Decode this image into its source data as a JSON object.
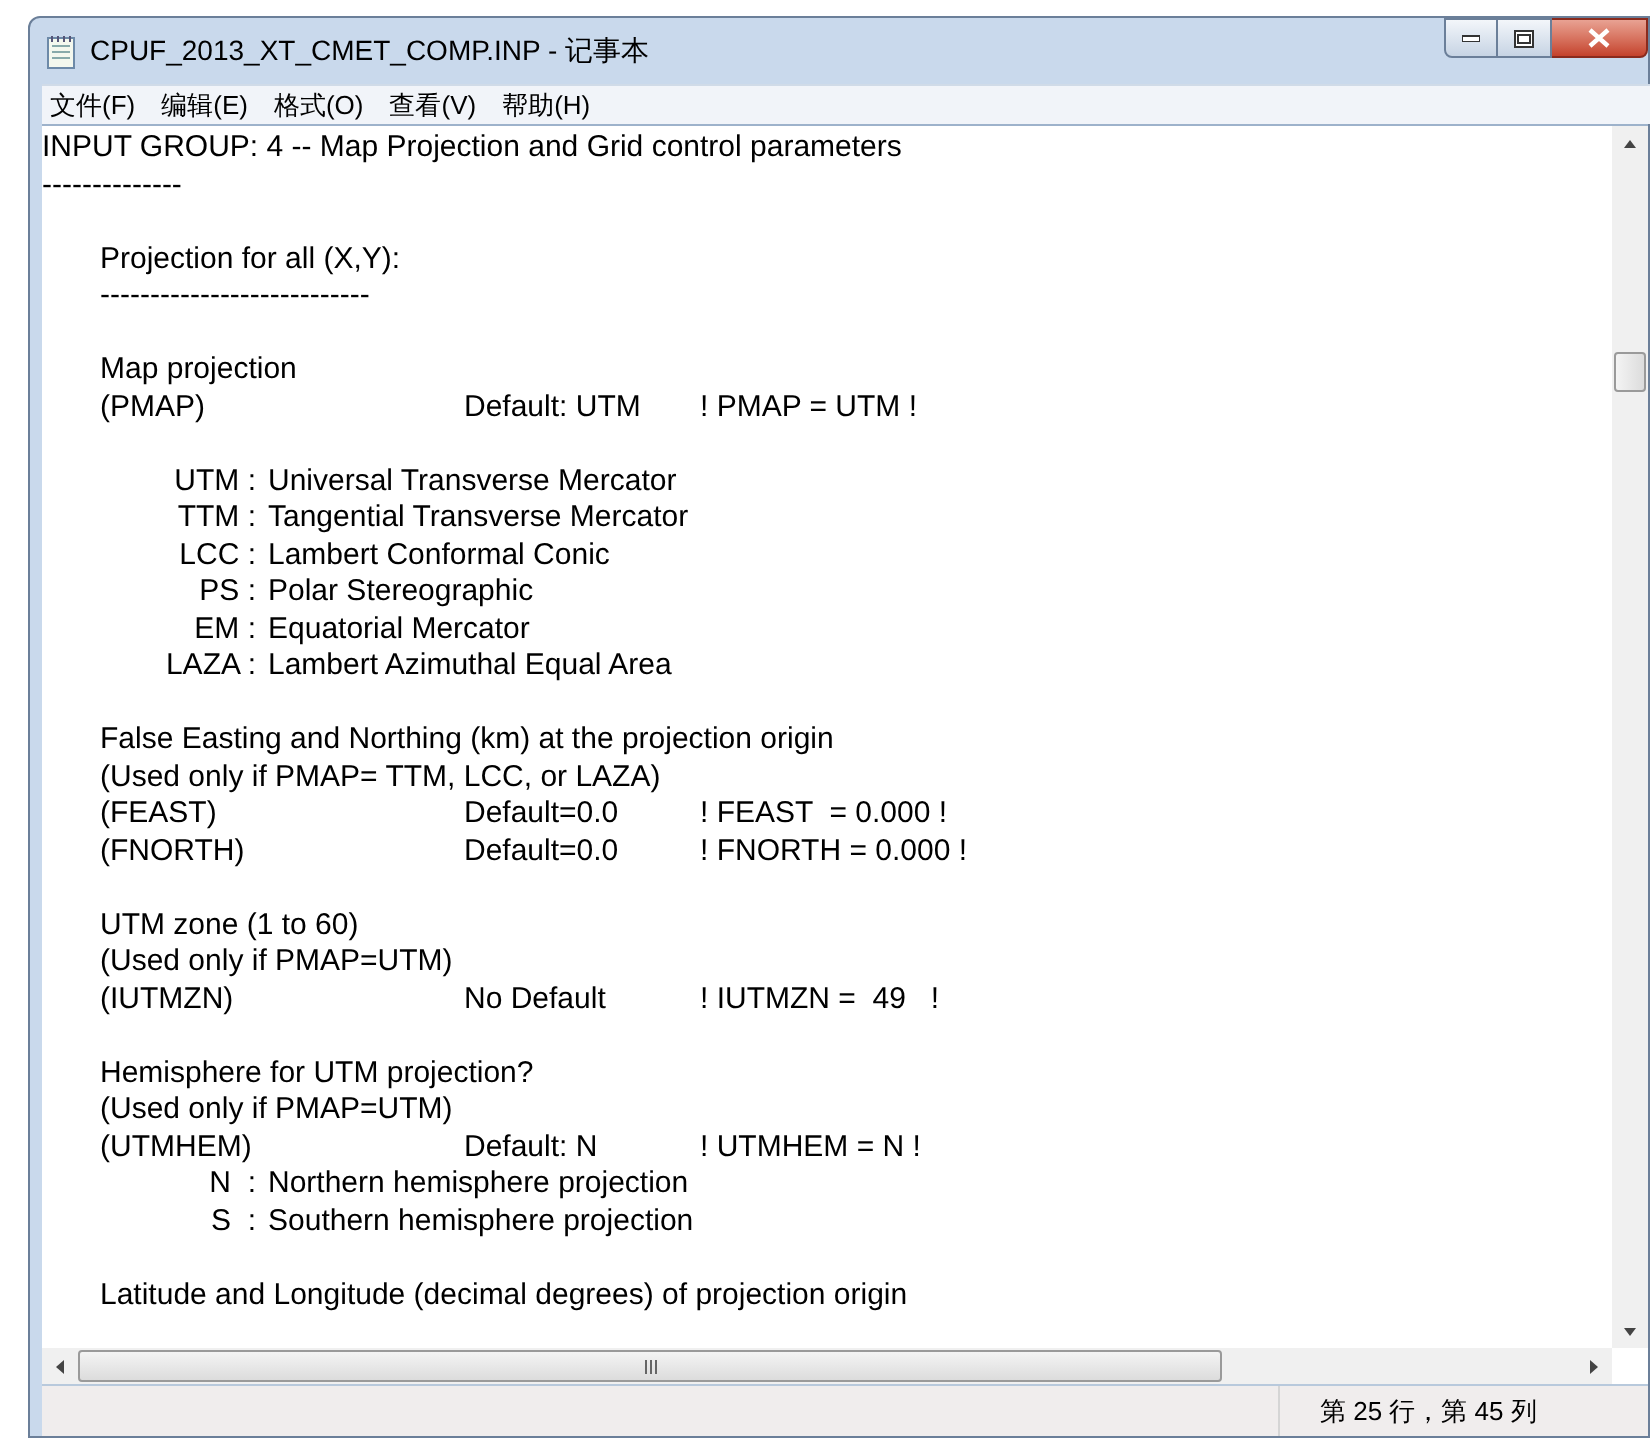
{
  "window": {
    "title": "CPUF_2013_XT_CMET_COMP.INP - 记事本"
  },
  "menu": [
    "文件(F)",
    "编辑(E)",
    "格式(O)",
    "查看(V)",
    "帮助(H)"
  ],
  "lines": [
    {
      "kind": "top",
      "text": "INPUT GROUP: 4 -- Map Projection and Grid control parameters"
    },
    {
      "kind": "top",
      "text": "--------------"
    },
    {
      "kind": "blank"
    },
    {
      "kind": "text",
      "text": "Projection for all (X,Y):"
    },
    {
      "kind": "text",
      "text": "---------------------------"
    },
    {
      "kind": "blank"
    },
    {
      "kind": "text",
      "text": "Map projection"
    },
    {
      "kind": "param",
      "name": "(PMAP)",
      "default": "Default: UTM",
      "value": "! PMAP = UTM !"
    },
    {
      "kind": "blank"
    },
    {
      "kind": "option",
      "code": "UTM :",
      "desc": "Universal Transverse Mercator"
    },
    {
      "kind": "option",
      "code": "TTM :",
      "desc": "Tangential Transverse Mercator"
    },
    {
      "kind": "option",
      "code": "LCC :",
      "desc": "Lambert Conformal Conic"
    },
    {
      "kind": "option",
      "code": "PS :",
      "desc": "Polar Stereographic"
    },
    {
      "kind": "option",
      "code": "EM :",
      "desc": "Equatorial Mercator"
    },
    {
      "kind": "option",
      "code": "LAZA :",
      "desc": "Lambert Azimuthal Equal Area"
    },
    {
      "kind": "blank"
    },
    {
      "kind": "text",
      "text": "False Easting and Northing (km) at the projection origin"
    },
    {
      "kind": "text",
      "text": "(Used only if PMAP= TTM, LCC, or LAZA)"
    },
    {
      "kind": "param",
      "name": "(FEAST)",
      "default": "Default=0.0",
      "value": "! FEAST  = 0.000 !"
    },
    {
      "kind": "param",
      "name": "(FNORTH)",
      "default": "Default=0.0",
      "value": "! FNORTH = 0.000 !"
    },
    {
      "kind": "blank"
    },
    {
      "kind": "text",
      "text": "UTM zone (1 to 60)"
    },
    {
      "kind": "text",
      "text": "(Used only if PMAP=UTM)"
    },
    {
      "kind": "param",
      "name": "(IUTMZN)",
      "default": "No Default",
      "value": "! IUTMZN =  49   !"
    },
    {
      "kind": "blank"
    },
    {
      "kind": "text",
      "text": "Hemisphere for UTM projection?"
    },
    {
      "kind": "text",
      "text": "(Used only if PMAP=UTM)"
    },
    {
      "kind": "param",
      "name": "(UTMHEM)",
      "default": "Default: N",
      "value": "! UTMHEM = N !"
    },
    {
      "kind": "option",
      "code": "N  :",
      "desc": "Northern hemisphere projection"
    },
    {
      "kind": "option",
      "code": "S  :",
      "desc": "Southern hemisphere projection"
    },
    {
      "kind": "blank"
    },
    {
      "kind": "text",
      "text": "Latitude and Longitude (decimal degrees) of projection origin"
    }
  ],
  "status_bar": {
    "position": "第 25 行，第 45 列"
  }
}
